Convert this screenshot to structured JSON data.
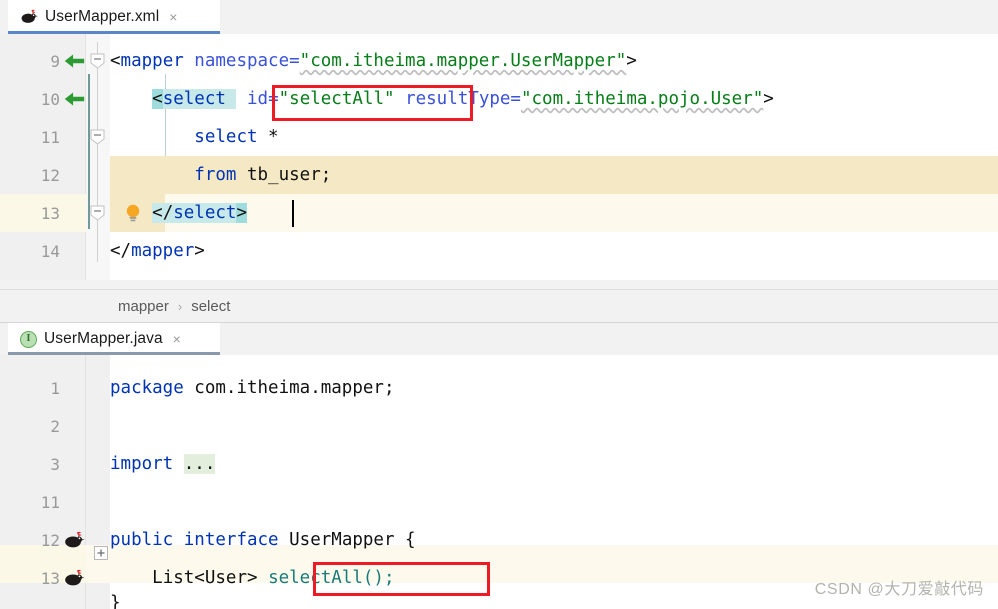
{
  "xml_tab": {
    "label": "UserMapper.xml",
    "icon": "mybatis-bird-icon",
    "close": "×"
  },
  "java_tab": {
    "label": "UserMapper.java",
    "icon": "java-interface-icon",
    "icon_letter": "I",
    "close": "×"
  },
  "xml_editor": {
    "lines": [
      {
        "num": "9",
        "gutter_icon": "green-left-arrow-icon",
        "fold": "collapse-chevron"
      },
      {
        "num": "10",
        "gutter_icon": "green-left-arrow-icon",
        "fold": "collapse-chevron"
      },
      {
        "num": "11",
        "gutter_icon": "",
        "fold": "collapse-chevron"
      },
      {
        "num": "12",
        "gutter_icon": "",
        "fold": "fold-end"
      },
      {
        "num": "13",
        "gutter_icon": "lightbulb-icon",
        "fold": "fold-end"
      },
      {
        "num": "14",
        "gutter_icon": "",
        "fold": "fold-end"
      }
    ],
    "code": {
      "l9_tag_open": "<",
      "l9_tag_name": "mapper",
      "l9_attr": " namespace=",
      "l9_val": "\"com.itheima.mapper.UserMapper\"",
      "l9_tag_close": ">",
      "l10_indent": "    ",
      "l10_tag_open": "<",
      "l10_tag_name": "select",
      "l10_attr_id": " id=",
      "l10_val_id": "\"selectAll\"",
      "l10_attr_rt": " resultType=",
      "l10_val_rt": "\"com.itheima.pojo.User\"",
      "l10_tag_close": ">",
      "l11": "        select *",
      "l11_kw": "select",
      "l11_rest": " *",
      "l12_kw": "from",
      "l12_rest": " tb_user;",
      "l13_open": "</",
      "l13_name": "select",
      "l13_close": ">",
      "l14_open": "</",
      "l14_name": "mapper",
      "l14_close": ">"
    }
  },
  "breadcrumb": {
    "items": [
      "mapper",
      "select"
    ],
    "separator": "›"
  },
  "java_editor": {
    "lines": [
      {
        "num": "1",
        "gutter_icon": "",
        "fold": ""
      },
      {
        "num": "2",
        "gutter_icon": "",
        "fold": ""
      },
      {
        "num": "3",
        "gutter_icon": "",
        "fold": "expand-plus"
      },
      {
        "num": "11",
        "gutter_icon": "",
        "fold": ""
      },
      {
        "num": "12",
        "gutter_icon": "mybatis-bird-icon",
        "fold": ""
      },
      {
        "num": "13",
        "gutter_icon": "mybatis-bird-icon",
        "fold": ""
      }
    ],
    "code": {
      "l1_kw": "package",
      "l1_rest": " com.itheima.mapper;",
      "l3_kw": "import",
      "l3_fold": "...",
      "l12_kw1": "public",
      "l12_kw2": "interface",
      "l12_name": "UserMapper",
      "l12_brace": "{",
      "l13_type": "List<User>",
      "l13_method": "selectAll();"
    }
  },
  "annotations": {
    "box1_target": "id=\"selectAll\"",
    "box2_target": "selectAll();",
    "box_color": "#ee1b24"
  },
  "watermark": {
    "text": "CSDN @大刀爱敲代码"
  },
  "theme": {
    "tab_active_bg": "#ffffff",
    "tab_underline": "#5b87c7",
    "gutter_bg": "#f0f0f0",
    "editor_bg": "#ffffff",
    "sql_block_highlight": "#f5e8c4",
    "current_line_highlight": "#fdfaed",
    "tag_match_highlight": "#c8e9ea",
    "fold_text_highlight": "#e3eedd",
    "tag_color": "#0033b3",
    "attr_color": "#3a51d9",
    "value_color": "#067d17",
    "method_color": "#1a7a7a"
  }
}
